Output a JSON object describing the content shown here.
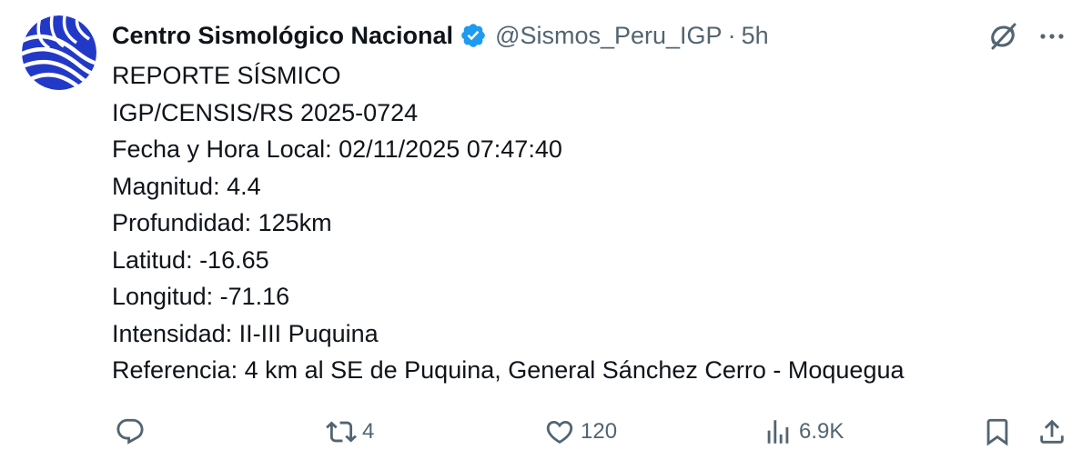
{
  "account": {
    "display_name": "Centro Sismológico Nacional",
    "handle": "@Sismos_Peru_IGP",
    "separator": "·",
    "time": "5h",
    "verified": true
  },
  "post": {
    "lines": [
      "REPORTE SÍSMICO",
      "IGP/CENSIS/RS 2025-0724",
      "Fecha y Hora Local: 02/11/2025 07:47:40",
      "Magnitud: 4.4",
      "Profundidad: 125km",
      "Latitud: -16.65",
      "Longitud: -71.16",
      "Intensidad: II-III Puquina",
      "Referencia: 4 km al SE de Puquina, General Sánchez Cerro - Moquegua"
    ]
  },
  "actions": {
    "reply": {
      "icon": "reply-icon",
      "count": ""
    },
    "retweet": {
      "icon": "retweet-icon",
      "count": "4"
    },
    "like": {
      "icon": "heart-icon",
      "count": "120"
    },
    "views": {
      "icon": "views-icon",
      "count": "6.9K"
    },
    "bookmark": {
      "icon": "bookmark-icon"
    },
    "share": {
      "icon": "share-icon"
    }
  },
  "icons": {
    "verified": "verified-badge-icon",
    "grok": "grok-icon",
    "more": "more-icon",
    "avatar": "igp-logo-icon"
  },
  "colors": {
    "text": "#0f1419",
    "secondary": "#536471",
    "verified_blue": "#1d9bf0",
    "avatar_blue": "#2239c8"
  }
}
